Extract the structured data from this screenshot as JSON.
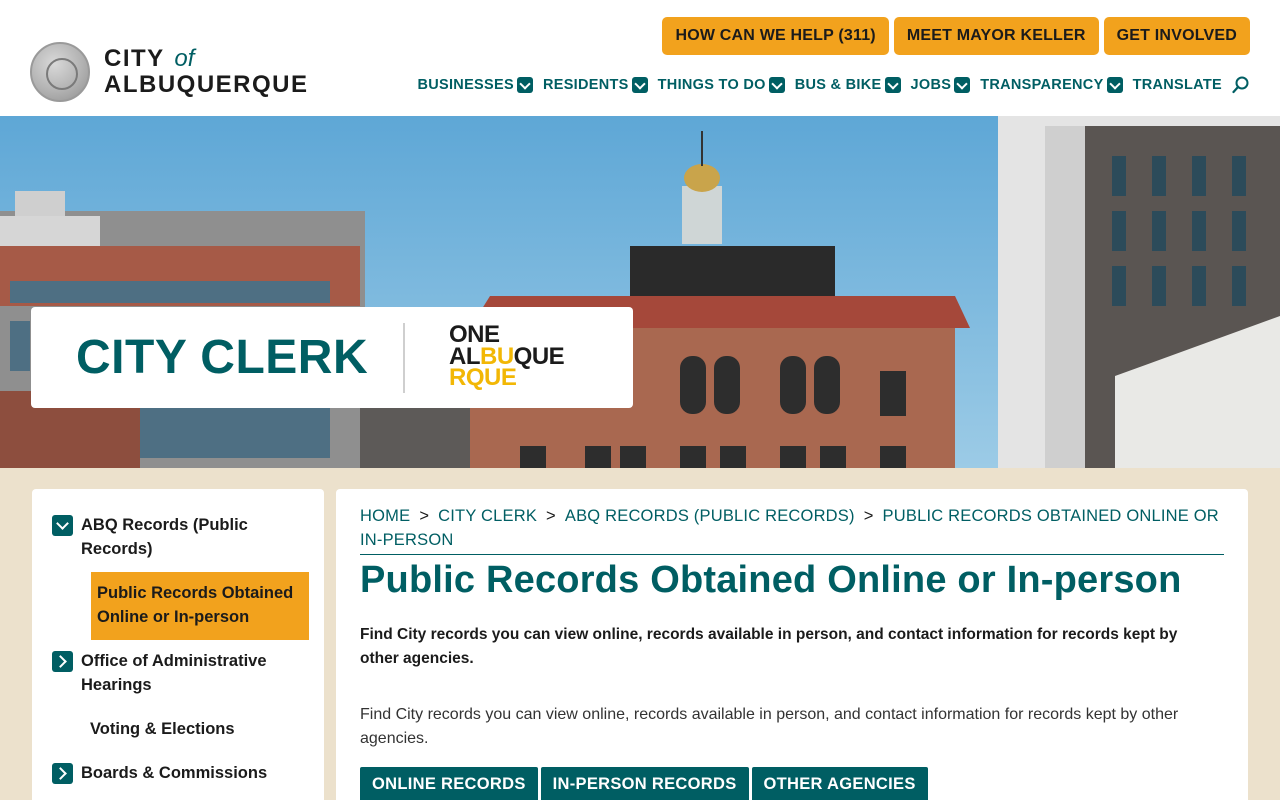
{
  "brand": {
    "line1": "CITY",
    "line1_of": "of",
    "line2": "ALBUQUERQUE"
  },
  "top_buttons": [
    {
      "label": "HOW CAN WE HELP (311)"
    },
    {
      "label": "MEET MAYOR KELLER"
    },
    {
      "label": "GET INVOLVED"
    }
  ],
  "nav": [
    {
      "label": "BUSINESSES"
    },
    {
      "label": "RESIDENTS"
    },
    {
      "label": "THINGS TO DO"
    },
    {
      "label": "BUS & BIKE"
    },
    {
      "label": "JOBS"
    },
    {
      "label": "TRANSPARENCY"
    },
    {
      "label": "TRANSLATE"
    }
  ],
  "hero": {
    "title": "CITY CLERK",
    "badge_line1": "ONE",
    "badge_line2a": "AL",
    "badge_line2b": "BU",
    "badge_line2c": "QUE",
    "badge_line3": "RQUE"
  },
  "sidebar": {
    "parent": "ABQ Records (Public Records)",
    "active": "Public Records Obtained Online or In-person",
    "items": [
      {
        "label": "Office of Administrative Hearings"
      },
      {
        "label": "Voting & Elections"
      },
      {
        "label": "Boards & Commissions"
      }
    ]
  },
  "breadcrumb": [
    "HOME",
    "CITY CLERK",
    "ABQ RECORDS (PUBLIC RECORDS)",
    "PUBLIC RECORDS OBTAINED ONLINE OR IN-PERSON"
  ],
  "breadcrumb_sep": ">",
  "page": {
    "title": "Public Records Obtained Online or In-person",
    "lead": "Find City records you can view online, records available in person, and contact information for records kept by other agencies.",
    "body": "Find City records you can view online, records available in person, and contact information for records kept by other agencies."
  },
  "tabs": [
    {
      "label": "ONLINE RECORDS"
    },
    {
      "label": "IN-PERSON RECORDS"
    },
    {
      "label": "OTHER AGENCIES"
    }
  ],
  "colors": {
    "teal": "#005e63",
    "orange": "#f2a21d",
    "beige": "#ece1cc",
    "yellow": "#f2b705"
  }
}
